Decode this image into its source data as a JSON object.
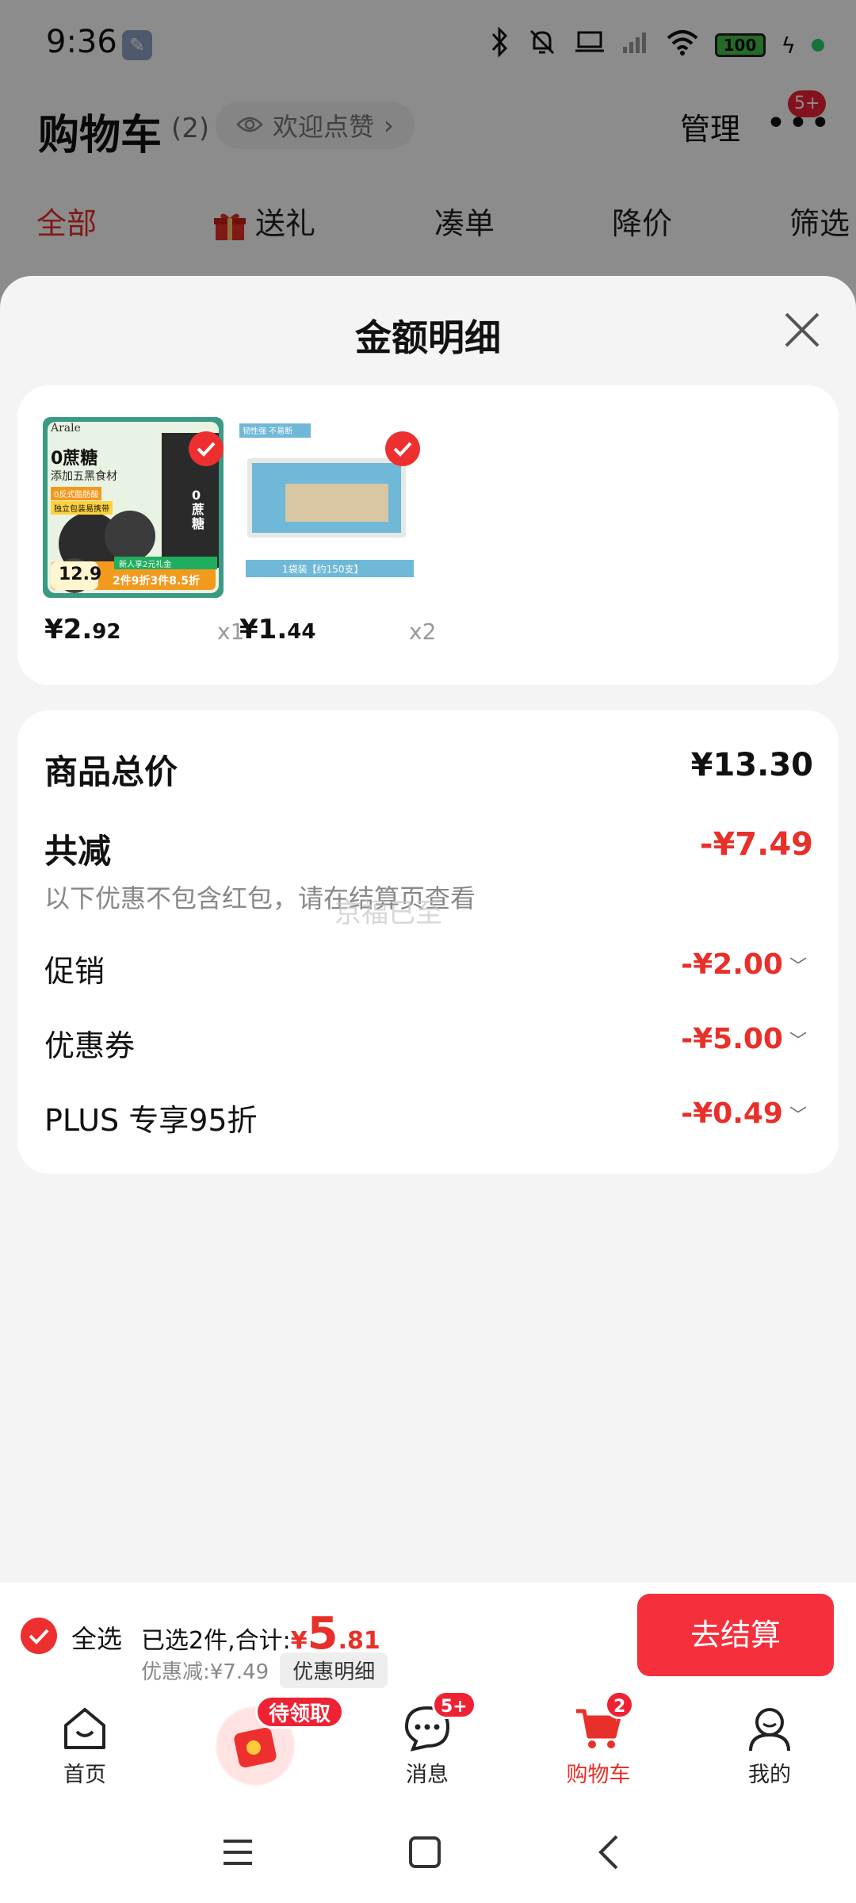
{
  "status_bar": {
    "time": "9:36",
    "battery": "100"
  },
  "header": {
    "title": "购物车",
    "count": "(2)",
    "like_pill": "欢迎点赞",
    "like_chevron": "›",
    "manage": "管理",
    "more_badge": "5+"
  },
  "filter_tabs": [
    {
      "label": "全部",
      "active": true
    },
    {
      "label": "送礼"
    },
    {
      "label": "凑单"
    },
    {
      "label": "降价"
    },
    {
      "label": "筛选"
    }
  ],
  "sheet": {
    "title": "金额明细",
    "products": [
      {
        "price_main": "¥2.",
        "price_cents": "92",
        "qty": "x1",
        "image_text": {
          "brand": "Arale",
          "line1": "0蔗糖",
          "line2": "添加五黑食材",
          "line3": "0反式脂肪酸",
          "line4": "独立包装易携带",
          "price_tag": "12.9",
          "promo": "2件9折3件8.5折",
          "promo2": "新人享2元礼金",
          "side": "0蔗糖"
        }
      },
      {
        "price_main": "¥1.",
        "price_cents": "44",
        "qty": "x2",
        "image_text": {
          "tag": "韧性强 不易断",
          "pack": "1袋装【约150支】"
        }
      }
    ],
    "summary": {
      "total_label": "商品总价",
      "total_value": "¥13.30",
      "reduce_label": "共减",
      "reduce_value": "-¥7.49",
      "note": "以下优惠不包含红包，请在结算页查看",
      "watermark": "京福已至",
      "items": [
        {
          "label": "促销",
          "value": "-¥2.00"
        },
        {
          "label": "优惠券",
          "value": "-¥5.00"
        },
        {
          "label": "PLUS 专享95折",
          "value": "-¥0.49"
        }
      ]
    }
  },
  "checkout": {
    "select_all": "全选",
    "selected_text": "已选2件,合计:",
    "yen": "¥",
    "total_int": "5",
    "total_dec": ".81",
    "discount_text": "优惠减:¥7.49",
    "detail_chip": "优惠明细",
    "button": "去结算"
  },
  "bottom_nav": {
    "home": "首页",
    "promo_tag": "待领取",
    "messages": "消息",
    "messages_badge": "5+",
    "cart": "购物车",
    "cart_badge": "2",
    "me": "我的"
  },
  "colors": {
    "accent": "#e8302a",
    "button": "#f5303c",
    "badge": "#ee2233"
  }
}
